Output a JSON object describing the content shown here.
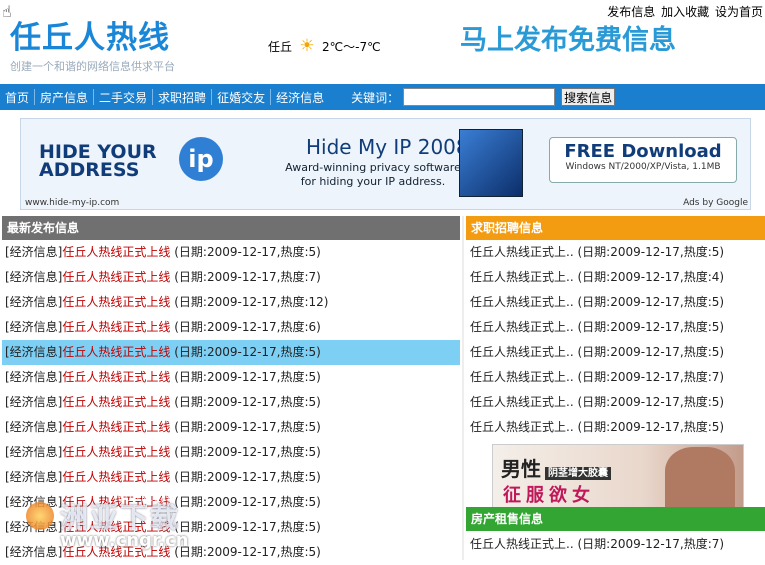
{
  "header": {
    "logo": "任丘人热线",
    "slogan": "创建一个和谐的网络信息供求平台",
    "weather_city": "任丘",
    "weather_temp": "2℃～-7℃",
    "promo": "马上发布免费信息",
    "toplinks": [
      "发布信息",
      "加入收藏",
      "设为首页"
    ]
  },
  "nav": {
    "items": [
      "首页",
      "房产信息",
      "二手交易",
      "求职招聘",
      "征婚交友",
      "经济信息"
    ],
    "keyword_label": "关键词：",
    "search_value": "",
    "search_button": "搜索信息"
  },
  "banner": {
    "logo_text": "HIDE YOUR ADDRESS",
    "logo_ip": "ip",
    "title": "Hide My IP 2008",
    "subtitle": "Award-winning privacy software for hiding your IP address.",
    "download": "FREE Download",
    "platforms": "Windows NT/2000/XP/Vista, 1.1MB",
    "url": "www.hide-my-ip.com",
    "ads_by": "Ads by Google"
  },
  "latest": {
    "heading": "最新发布信息",
    "items": [
      {
        "cat": "[经济信息]",
        "title": "任丘人热线正式上线",
        "meta": "(日期:2009-12-17,热度:5)"
      },
      {
        "cat": "[经济信息]",
        "title": "任丘人热线正式上线",
        "meta": "(日期:2009-12-17,热度:7)"
      },
      {
        "cat": "[经济信息]",
        "title": "任丘人热线正式上线",
        "meta": "(日期:2009-12-17,热度:12)"
      },
      {
        "cat": "[经济信息]",
        "title": "任丘人热线正式上线",
        "meta": "(日期:2009-12-17,热度:6)"
      },
      {
        "cat": "[经济信息]",
        "title": "任丘人热线正式上线",
        "meta": "(日期:2009-12-17,热度:5)"
      },
      {
        "cat": "[经济信息]",
        "title": "任丘人热线正式上线",
        "meta": "(日期:2009-12-17,热度:5)"
      },
      {
        "cat": "[经济信息]",
        "title": "任丘人热线正式上线",
        "meta": "(日期:2009-12-17,热度:5)"
      },
      {
        "cat": "[经济信息]",
        "title": "任丘人热线正式上线",
        "meta": "(日期:2009-12-17,热度:5)"
      },
      {
        "cat": "[经济信息]",
        "title": "任丘人热线正式上线",
        "meta": "(日期:2009-12-17,热度:5)"
      },
      {
        "cat": "[经济信息]",
        "title": "任丘人热线正式上线",
        "meta": "(日期:2009-12-17,热度:5)"
      },
      {
        "cat": "[经济信息]",
        "title": "任丘人热线正式上线",
        "meta": "(日期:2009-12-17,热度:5)"
      },
      {
        "cat": "[经济信息]",
        "title": "任丘人热线正式上线",
        "meta": "(日期:2009-12-17,热度:5)"
      },
      {
        "cat": "[经济信息]",
        "title": "任丘人热线正式上线",
        "meta": "(日期:2009-12-17,热度:5)"
      }
    ],
    "highlighted_index": 4
  },
  "jobs": {
    "heading": "求职招聘信息",
    "items": [
      {
        "title": "任丘人热线正式上..",
        "meta": "(日期:2009-12-17,热度:5)"
      },
      {
        "title": "任丘人热线正式上..",
        "meta": "(日期:2009-12-17,热度:4)"
      },
      {
        "title": "任丘人热线正式上..",
        "meta": "(日期:2009-12-17,热度:5)"
      },
      {
        "title": "任丘人热线正式上..",
        "meta": "(日期:2009-12-17,热度:5)"
      },
      {
        "title": "任丘人热线正式上..",
        "meta": "(日期:2009-12-17,热度:5)"
      },
      {
        "title": "任丘人热线正式上..",
        "meta": "(日期:2009-12-17,热度:7)"
      },
      {
        "title": "任丘人热线正式上..",
        "meta": "(日期:2009-12-17,热度:5)"
      },
      {
        "title": "任丘人热线正式上..",
        "meta": "(日期:2009-12-17,热度:5)"
      }
    ]
  },
  "ad2": {
    "line1": "男性",
    "tag": "阴茎增大胶囊",
    "line2": "征服欲女"
  },
  "rent": {
    "heading": "房产租售信息",
    "items": [
      {
        "title": "任丘人热线正式上..",
        "meta": "(日期:2009-12-17,热度:7)"
      }
    ]
  },
  "watermark": {
    "line1": "CNGR SOFTWARE DOWNLOAD",
    "line2": "洲亚下载",
    "line3": "www.cngr.cn"
  }
}
